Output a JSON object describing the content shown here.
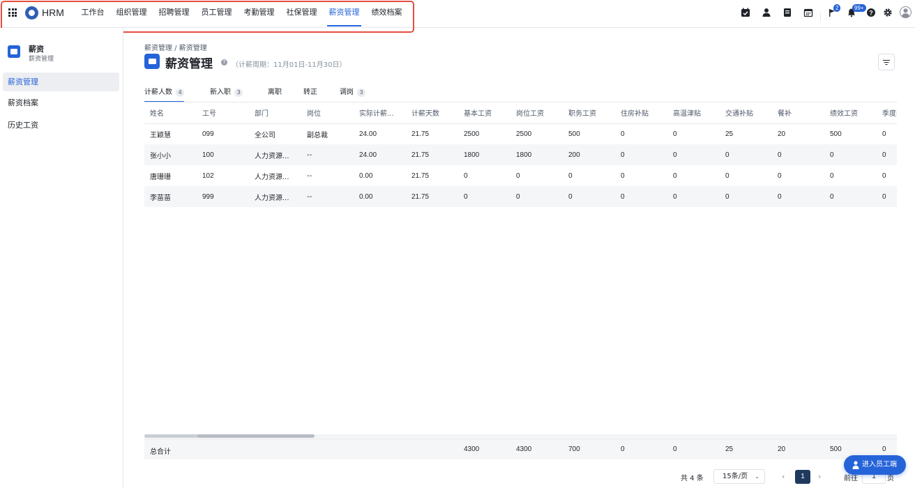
{
  "app": {
    "brand": "HRM",
    "nav": [
      "工作台",
      "组织管理",
      "招聘管理",
      "员工管理",
      "考勤管理",
      "社保管理",
      "薪资管理",
      "绩效档案"
    ],
    "active_nav": "薪资管理",
    "badges": {
      "flag": "2",
      "bell": "99+"
    },
    "icons": [
      "calendar-check-icon",
      "user-icon",
      "document-icon",
      "calendar-icon",
      "flag-icon",
      "bell-icon",
      "help-icon",
      "gear-icon",
      "avatar-icon"
    ],
    "accent": "#2563d9",
    "highlight_color": "#e34d3f"
  },
  "sidebar": {
    "title": "薪资",
    "subtitle": "薪资管理",
    "items": [
      "薪资管理",
      "薪资档案",
      "历史工资"
    ],
    "active": "薪资管理"
  },
  "breadcrumb": "薪资管理 / 薪资管理",
  "page": {
    "title": "薪资管理",
    "period": "（计薪周期：11月01日-11月30日）"
  },
  "tabs": [
    {
      "label": "计薪人数",
      "count": "4"
    },
    {
      "label": "新入职",
      "count": "3"
    },
    {
      "label": "离职",
      "count": ""
    },
    {
      "label": "转正",
      "count": ""
    },
    {
      "label": "调岗",
      "count": "3"
    }
  ],
  "table": {
    "columns": [
      "姓名",
      "工号",
      "部门",
      "岗位",
      "实际计薪...",
      "计薪天数",
      "基本工资",
      "岗位工资",
      "职务工资",
      "住房补贴",
      "高温津贴",
      "交通补贴",
      "餐补",
      "绩效工资",
      "季度奖"
    ],
    "rows": [
      [
        "王颖慧",
        "099",
        "全公司",
        "副总裁",
        "24.00",
        "21.75",
        "2500",
        "2500",
        "500",
        "0",
        "0",
        "25",
        "20",
        "500",
        "0"
      ],
      [
        "张小小",
        "100",
        "人力资源...",
        "--",
        "24.00",
        "21.75",
        "1800",
        "1800",
        "200",
        "0",
        "0",
        "0",
        "0",
        "0",
        "0"
      ],
      [
        "唐珊珊",
        "102",
        "人力资源...",
        "--",
        "0.00",
        "21.75",
        "0",
        "0",
        "0",
        "0",
        "0",
        "0",
        "0",
        "0",
        "0"
      ],
      [
        "李苗苗",
        "999",
        "人力资源...",
        "--",
        "0.00",
        "21.75",
        "0",
        "0",
        "0",
        "0",
        "0",
        "0",
        "0",
        "0",
        "0"
      ]
    ]
  },
  "summary": {
    "label": "总合计",
    "values": [
      "4300",
      "4300",
      "700",
      "0",
      "0",
      "25",
      "20",
      "500",
      "0"
    ]
  },
  "pagination": {
    "total": "共 4 条",
    "page_size": "15条/页",
    "current": "1",
    "goto_label": "前往",
    "goto_value": "1",
    "goto_suffix": "页"
  },
  "employee_button": "进入员工端"
}
